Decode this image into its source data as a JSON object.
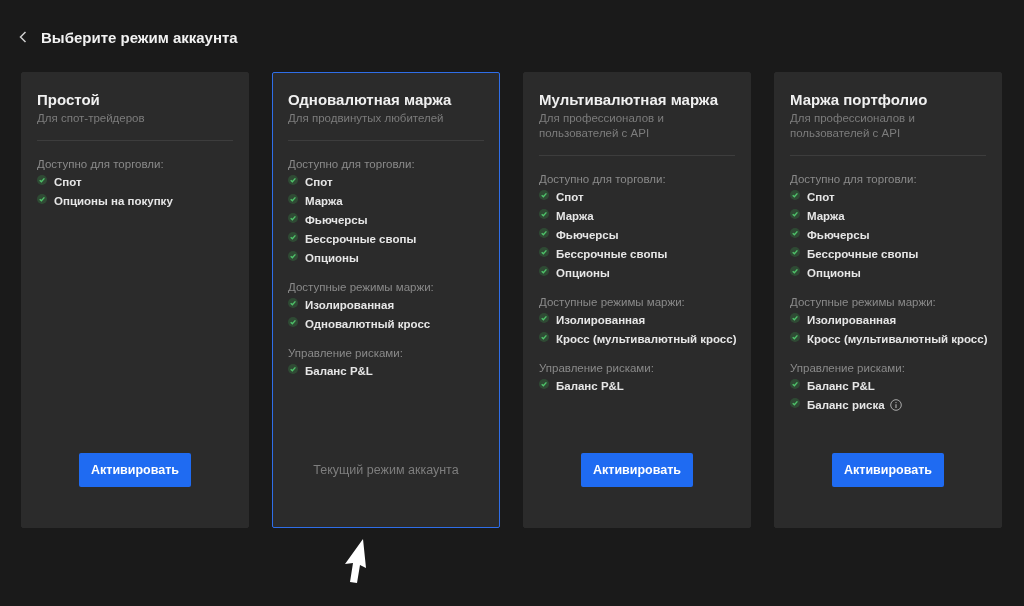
{
  "header": {
    "title": "Выберите режим аккаунта"
  },
  "cards": [
    {
      "title": "Простой",
      "subtitle": "Для спот-трейдеров",
      "selected": false,
      "sections": [
        {
          "heading": "Доступно для торговли:",
          "items": [
            {
              "label": "Спот",
              "checked": true
            },
            {
              "label": "Опционы на покупку",
              "checked": true
            }
          ]
        }
      ],
      "action": {
        "kind": "button",
        "label": "Активировать"
      }
    },
    {
      "title": "Одновалютная маржа",
      "subtitle": "Для продвинутых любителей",
      "selected": true,
      "sections": [
        {
          "heading": "Доступно для торговли:",
          "items": [
            {
              "label": "Спот",
              "checked": true
            },
            {
              "label": "Маржа",
              "checked": true
            },
            {
              "label": "Фьючерсы",
              "checked": true
            },
            {
              "label": "Бессрочные свопы",
              "checked": true
            },
            {
              "label": "Опционы",
              "checked": true
            }
          ]
        },
        {
          "heading": "Доступные режимы маржи:",
          "items": [
            {
              "label": "Изолированная",
              "checked": true
            },
            {
              "label": "Одновалютный кросс",
              "checked": true
            }
          ]
        },
        {
          "heading": "Управление рисками:",
          "items": [
            {
              "label": "Баланс P&L",
              "checked": true
            }
          ]
        }
      ],
      "action": {
        "kind": "status",
        "label": "Текущий режим аккаунта"
      }
    },
    {
      "title": "Мультивалютная маржа",
      "subtitle": "Для профессионалов и пользователей с API",
      "selected": false,
      "sections": [
        {
          "heading": "Доступно для торговли:",
          "items": [
            {
              "label": "Спот",
              "checked": true
            },
            {
              "label": "Маржа",
              "checked": true
            },
            {
              "label": "Фьючерсы",
              "checked": true
            },
            {
              "label": "Бессрочные свопы",
              "checked": true
            },
            {
              "label": "Опционы",
              "checked": true
            }
          ]
        },
        {
          "heading": "Доступные режимы маржи:",
          "items": [
            {
              "label": "Изолированная",
              "checked": true
            },
            {
              "label": "Кросс (мультивалютный кросс)",
              "checked": true
            }
          ]
        },
        {
          "heading": "Управление рисками:",
          "items": [
            {
              "label": "Баланс P&L",
              "checked": true
            }
          ]
        }
      ],
      "action": {
        "kind": "button",
        "label": "Активировать"
      }
    },
    {
      "title": "Маржа портфолио",
      "subtitle": "Для профессионалов и пользователей с API",
      "selected": false,
      "sections": [
        {
          "heading": "Доступно для торговли:",
          "items": [
            {
              "label": "Спот",
              "checked": true
            },
            {
              "label": "Маржа",
              "checked": true
            },
            {
              "label": "Фьючерсы",
              "checked": true
            },
            {
              "label": "Бессрочные свопы",
              "checked": true
            },
            {
              "label": "Опционы",
              "checked": true
            }
          ]
        },
        {
          "heading": "Доступные режимы маржи:",
          "items": [
            {
              "label": "Изолированная",
              "checked": true
            },
            {
              "label": "Кросс (мультивалютный кросс)",
              "checked": true
            }
          ]
        },
        {
          "heading": "Управление рисками:",
          "items": [
            {
              "label": "Баланс P&L",
              "checked": true
            },
            {
              "label": "Баланс риска",
              "checked": true,
              "info": true
            }
          ]
        }
      ],
      "action": {
        "kind": "button",
        "label": "Активировать"
      }
    }
  ]
}
